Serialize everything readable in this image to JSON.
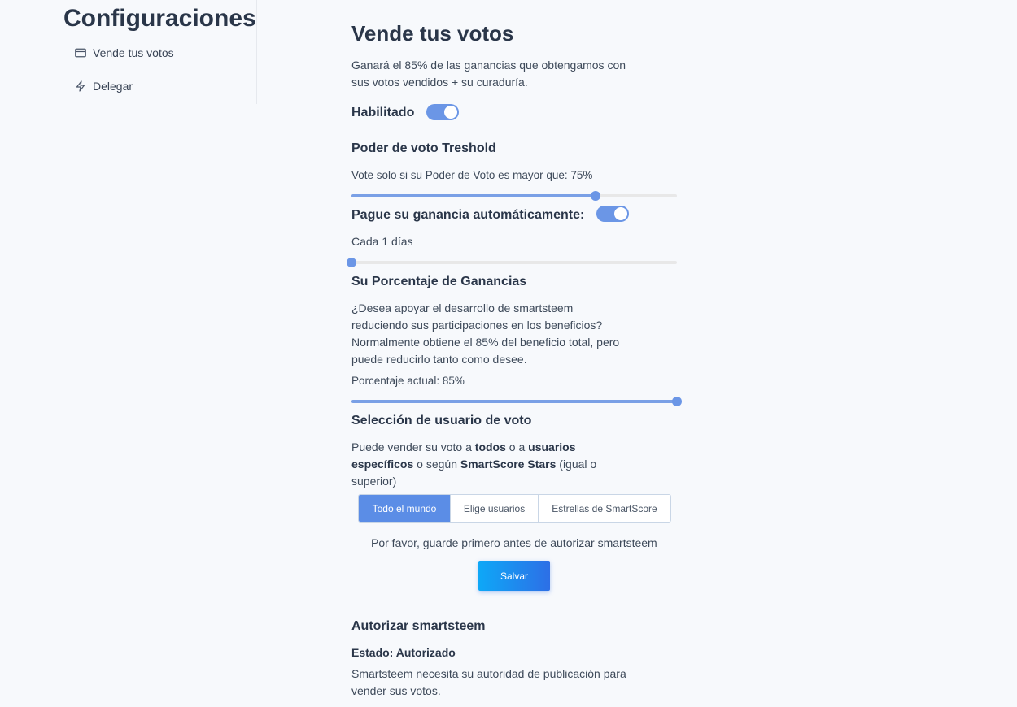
{
  "sidebar": {
    "title": "Configuraciones",
    "items": [
      {
        "label": "Vende tus votos",
        "icon": "credit-card-icon"
      },
      {
        "label": "Delegar",
        "icon": "lightning-icon"
      }
    ]
  },
  "main": {
    "title": "Vende tus votos",
    "intro": [
      "Ganará el 85% de las ganancias que obtengamos con",
      "sus votos vendidos + su curaduría."
    ],
    "enabled_label": "Habilitado",
    "enabled": true,
    "threshold": {
      "heading": "Poder de voto Treshold",
      "text": "Vote solo si su Poder de Voto es mayor que: 75%",
      "value_percent": 75
    },
    "autopay": {
      "label": "Pague su ganancia automáticamente:",
      "enabled": true,
      "text": "Cada 1 días",
      "value_percent": 0
    },
    "percentage": {
      "heading": "Su Porcentaje de Ganancias",
      "text": [
        "¿Desea apoyar el desarrollo de smartsteem",
        "reduciendo sus participaciones en los beneficios?",
        "Normalmente obtiene el 85% del beneficio total, pero",
        "puede reducirlo tanto como desee."
      ],
      "current": "Porcentaje actual: 85%",
      "value_percent": 100
    },
    "selection": {
      "heading": "Selección de usuario de voto",
      "text_parts": {
        "a": "Puede vender su voto a ",
        "b": "todos",
        "c": " o a ",
        "d": "usuarios",
        "e": "específicos",
        "f": " o según ",
        "g": "SmartScore Stars",
        "h": " (igual o",
        "i": "superior)"
      },
      "options": [
        "Todo el mundo",
        "Elige usuarios",
        "Estrellas de SmartScore"
      ],
      "selected": "Todo el mundo"
    },
    "save_note": "Por favor, guarde primero antes de autorizar smartsteem",
    "save_label": "Salvar",
    "authorize": {
      "heading": "Autorizar smartsteem",
      "status": "Estado: Autorizado",
      "text": [
        "Smartsteem necesita su autoridad de publicación para",
        "vender sus votos."
      ]
    }
  },
  "colors": {
    "accent": "#6b96e6",
    "slider_track": "#e8e8e8",
    "save_gradient_start": "#0ea8f7",
    "save_gradient_end": "#2d6fe6"
  }
}
